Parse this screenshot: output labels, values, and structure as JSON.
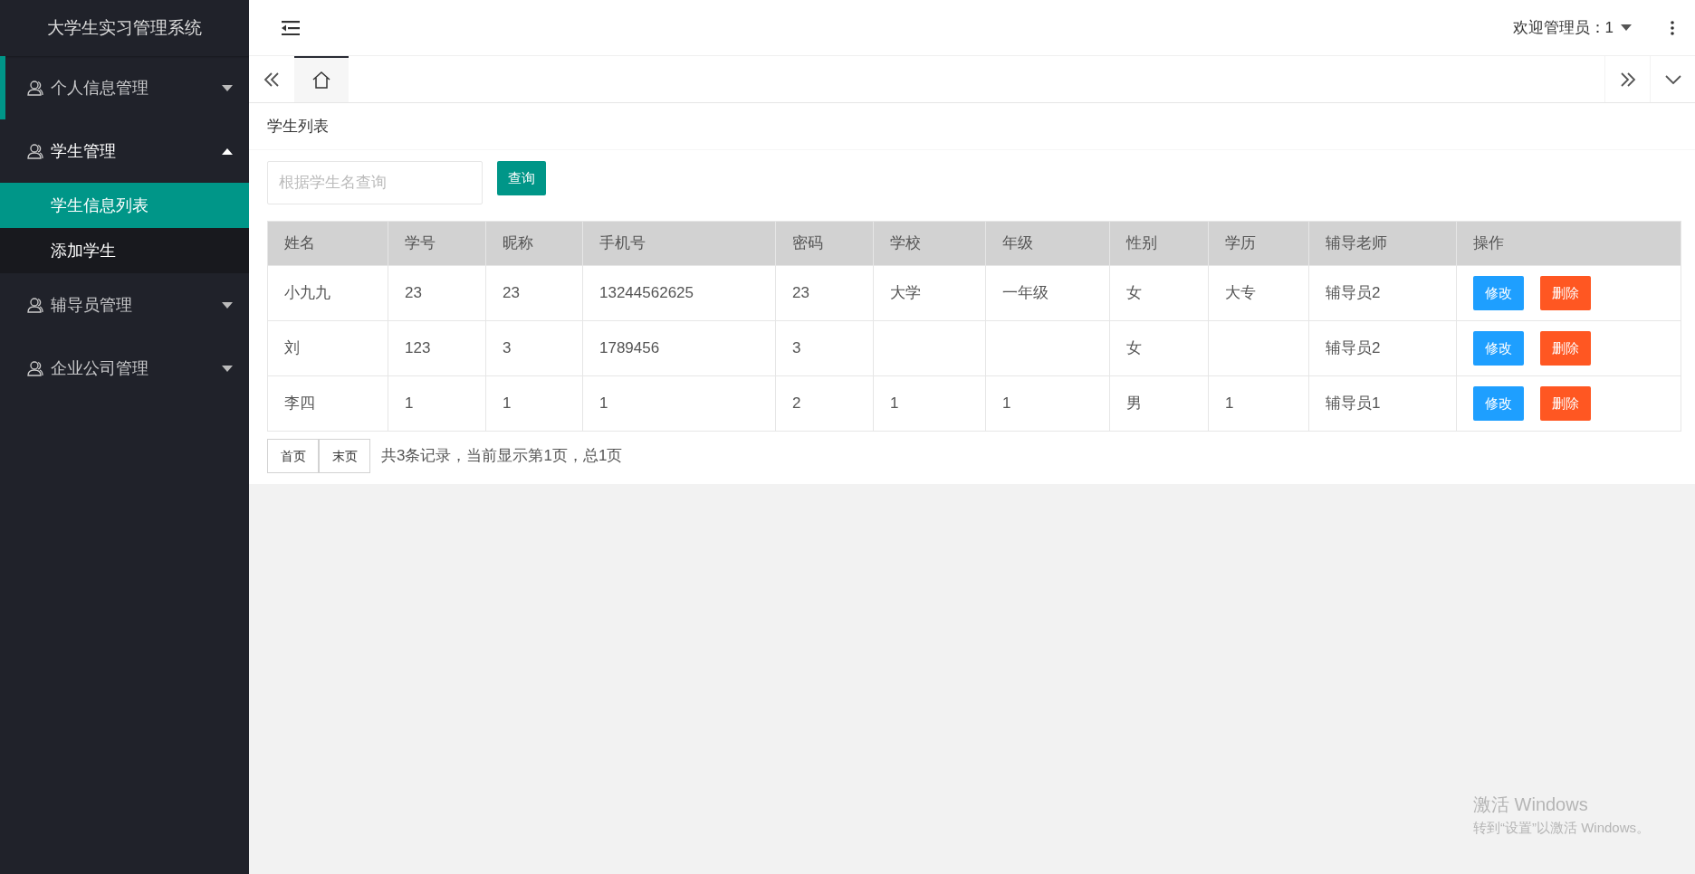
{
  "app_title": "大学生实习管理系统",
  "header": {
    "user_label": "欢迎管理员：1"
  },
  "sidebar": {
    "items": [
      {
        "label": "个人信息管理",
        "expanded": false,
        "hovered": true
      },
      {
        "label": "学生管理",
        "expanded": true,
        "hovered": false,
        "children": [
          {
            "label": "学生信息列表",
            "selected": true
          },
          {
            "label": "添加学生",
            "selected": false
          }
        ]
      },
      {
        "label": "辅导员管理",
        "expanded": false,
        "hovered": false
      },
      {
        "label": "企业公司管理",
        "expanded": false,
        "hovered": false
      }
    ]
  },
  "tabs": [
    {
      "kind": "home",
      "selected": true
    }
  ],
  "panel": {
    "title": "学生列表",
    "search": {
      "placeholder": "根据学生名查询",
      "button": "查询"
    },
    "table": {
      "columns": [
        "姓名",
        "学号",
        "昵称",
        "手机号",
        "密码",
        "学校",
        "年级",
        "性别",
        "学历",
        "辅导老师",
        "操作"
      ],
      "rows": [
        {
          "cells": [
            "小九九",
            "23",
            "23",
            "13244562625",
            "23",
            "大学",
            "一年级",
            "女",
            "大专",
            "辅导员2"
          ],
          "actions": [
            "修改",
            "删除"
          ]
        },
        {
          "cells": [
            "刘",
            "123",
            "3",
            "1789456",
            "3",
            "",
            "",
            "女",
            "",
            "辅导员2"
          ],
          "actions": [
            "修改",
            "删除"
          ]
        },
        {
          "cells": [
            "李四",
            "1",
            "1",
            "1",
            "2",
            "1",
            "1",
            "男",
            "1",
            "辅导员1"
          ],
          "actions": [
            "修改",
            "删除"
          ]
        }
      ]
    },
    "pager": {
      "buttons": [
        "首页",
        "末页"
      ],
      "summary": "共3条记录，当前显示第1页，总1页"
    }
  },
  "os_notice": {
    "title": "激活 Windows",
    "text": "转到“设置”以激活 Windows。"
  }
}
